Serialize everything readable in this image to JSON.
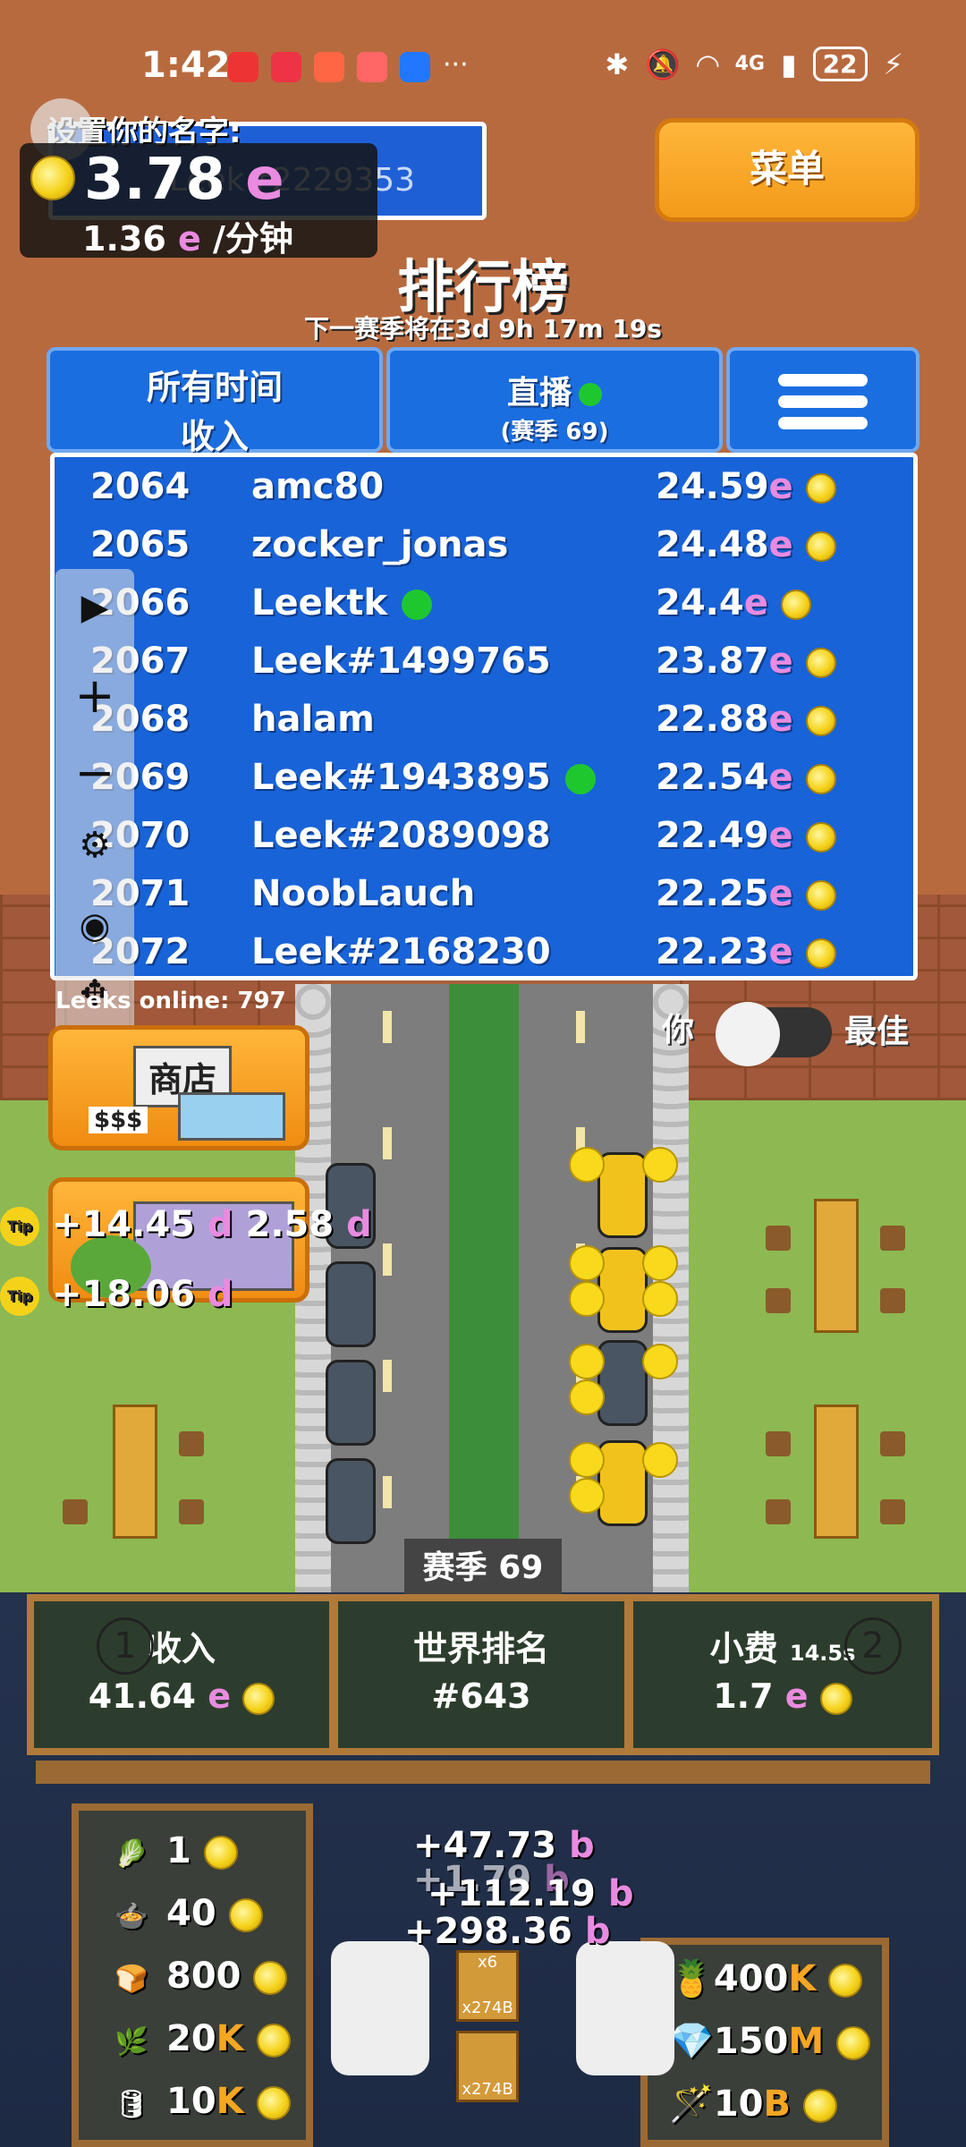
{
  "status_bar": {
    "time": "1:42",
    "network": "4G",
    "battery": "22",
    "app_icons": [
      "huawei-icon",
      "book-icon",
      "app-icon",
      "health-icon",
      "bulb-icon"
    ],
    "more": "···"
  },
  "profile": {
    "name_label": "设置你的名字:",
    "name_value": "Leek#2229353",
    "currency_value": "3.78",
    "currency_unit": "e",
    "rate_value": "1.36",
    "rate_unit": "e",
    "rate_suffix": "/分钟"
  },
  "menu_button": "菜单",
  "leaderboard": {
    "title": "排行榜",
    "countdown": "下一赛季将在3d 9h 17m 19s",
    "tabs": [
      {
        "line1": "所有时间",
        "line2": "收入"
      },
      {
        "line1": "直播",
        "line2": "(赛季 69)"
      }
    ],
    "rows": [
      {
        "rank": "2064",
        "name": "amc80",
        "score": "24.59",
        "online": false
      },
      {
        "rank": "2065",
        "name": "zocker_jonas",
        "score": "24.48",
        "online": false
      },
      {
        "rank": "2066",
        "name": "Leektk",
        "score": "24.4",
        "online": true
      },
      {
        "rank": "2067",
        "name": "Leek#1499765",
        "score": "23.87",
        "online": false
      },
      {
        "rank": "2068",
        "name": "halam",
        "score": "22.88",
        "online": false
      },
      {
        "rank": "2069",
        "name": "Leek#1943895",
        "score": "22.54",
        "online": true
      },
      {
        "rank": "2070",
        "name": "Leek#2089098",
        "score": "22.49",
        "online": false
      },
      {
        "rank": "2071",
        "name": "NoobLauch",
        "score": "22.25",
        "online": false
      },
      {
        "rank": "2072",
        "name": "Leek#2168230",
        "score": "22.23",
        "online": false
      }
    ],
    "score_unit": "e",
    "online_text": "Leeks online: 797"
  },
  "toggle": {
    "left_label": "你",
    "right_label": "最佳"
  },
  "shop": {
    "label": "商店",
    "price_tag": "$$$"
  },
  "tips": [
    {
      "badge": "Tip",
      "text": "+14.45",
      "unit": "d",
      "extra": "2.58",
      "extra_unit": "d"
    },
    {
      "badge": "Tip",
      "text": "+18.06",
      "unit": "d"
    }
  ],
  "season_label": "赛季 69",
  "stats": {
    "income_label": "收入",
    "income_value": "41.64",
    "income_unit": "e",
    "rank_label": "世界排名",
    "rank_value": "#643",
    "tips_label": "小费",
    "tips_timer": "14.5s",
    "tips_value": "1.7",
    "tips_unit": "e",
    "left_slot": "1",
    "right_slot": "2"
  },
  "gains": [
    "+47.73",
    "+1.79",
    "+112.19",
    "+298.36"
  ],
  "gain_units": [
    "b",
    "b",
    "b",
    "b"
  ],
  "crates": [
    {
      "mult": "x6",
      "amount": "x274B"
    },
    {
      "mult": "",
      "amount": "x274B"
    }
  ],
  "left_upgrades": [
    {
      "icon": "leek-icon",
      "value": "1",
      "suffix": ""
    },
    {
      "icon": "pot-icon",
      "value": "40",
      "suffix": ""
    },
    {
      "icon": "bread-icon",
      "value": "800",
      "suffix": ""
    },
    {
      "icon": "leek-stalk-icon",
      "value": "20",
      "suffix": "K"
    },
    {
      "icon": "barrel-icon",
      "value": "10",
      "suffix": "K"
    }
  ],
  "right_upgrades": [
    {
      "icon": "pineapple-icon",
      "value": "400",
      "suffix": "K"
    },
    {
      "icon": "crystal-icon",
      "value": "150",
      "suffix": "M"
    },
    {
      "icon": "wand-icon",
      "value": "10",
      "suffix": "B"
    }
  ],
  "colors": {
    "currency_e": "#e98be0",
    "suffix_orange": "#f5a623",
    "online_dot": "#1fc72f",
    "leaderboard_blue": "#1863d8"
  }
}
